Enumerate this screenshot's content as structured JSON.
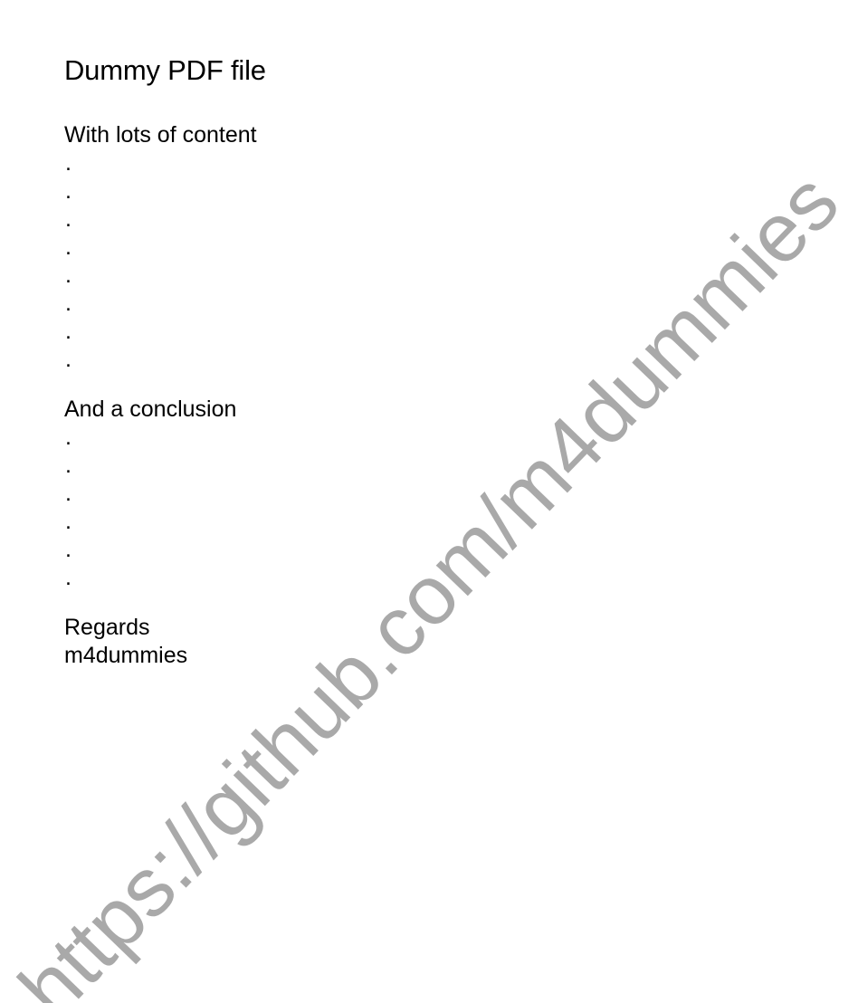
{
  "document": {
    "title": "Dummy PDF file",
    "section1_heading": "With lots of content",
    "section1_dots": [
      ".",
      ".",
      ".",
      ".",
      ".",
      ".",
      ".",
      "."
    ],
    "section2_heading": "And a conclusion",
    "section2_dots": [
      ".",
      ".",
      ".",
      ".",
      ".",
      "."
    ],
    "closing": "Regards",
    "signature": "m4dummies"
  },
  "watermark": {
    "text": "https://github.com/m4dummies",
    "color": "#a9a9a9"
  }
}
